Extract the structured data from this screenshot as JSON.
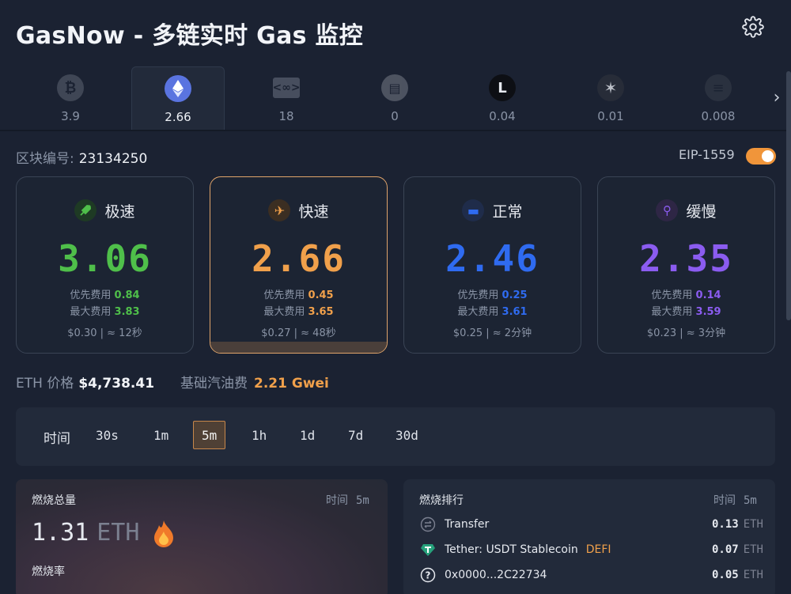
{
  "header": {
    "title": "GasNow - 多链实时 Gas 监控"
  },
  "chains": [
    {
      "icon": "bitcoin-icon",
      "value": "3.9"
    },
    {
      "icon": "ethereum-icon",
      "value": "2.66",
      "active": true
    },
    {
      "icon": "chain-link-icon",
      "value": "18"
    },
    {
      "icon": "scroll-icon",
      "value": "0"
    },
    {
      "icon": "linea-icon",
      "value": "0.04"
    },
    {
      "icon": "starknet-icon",
      "value": "0.01"
    },
    {
      "icon": "dim-chain-icon",
      "value": "0.008"
    }
  ],
  "block": {
    "label": "区块编号:",
    "number": "23134250"
  },
  "eip": {
    "label": "EIP-1559",
    "enabled": true
  },
  "cards": [
    {
      "title": "极速",
      "price": "3.06",
      "priority_label": "优先费用",
      "priority": "0.84",
      "max_label": "最大费用",
      "max": "3.83",
      "footer": "$0.30 | ≈ 12秒",
      "color": "#4fbf4a",
      "icon": "rocket-icon"
    },
    {
      "title": "快速",
      "price": "2.66",
      "priority_label": "优先费用",
      "priority": "0.45",
      "max_label": "最大费用",
      "max": "3.65",
      "footer": "$0.27 | ≈ 48秒",
      "color": "#f0a04b",
      "icon": "plane-icon"
    },
    {
      "title": "正常",
      "price": "2.46",
      "priority_label": "优先费用",
      "priority": "0.25",
      "max_label": "最大费用",
      "max": "3.61",
      "footer": "$0.25 | ≈ 2分钟",
      "color": "#2f6bf0",
      "icon": "car-icon"
    },
    {
      "title": "缓慢",
      "price": "2.35",
      "priority_label": "优先费用",
      "priority": "0.14",
      "max_label": "最大费用",
      "max": "3.59",
      "footer": "$0.23 | ≈ 3分钟",
      "color": "#8b5cf0",
      "icon": "bike-icon"
    }
  ],
  "stats": {
    "eth_label": "ETH 价格",
    "eth_price": "$4,738.41",
    "base_label": "基础汽油费",
    "base_fee": "2.21 Gwei"
  },
  "time_filter": {
    "label": "时间",
    "options": [
      "30s",
      "1m",
      "5m",
      "1h",
      "1d",
      "7d",
      "30d"
    ],
    "selected": "5m"
  },
  "burn": {
    "title": "燃烧总量",
    "time_label": "时间",
    "time_value": "5m",
    "amount": "1.31",
    "unit": "ETH",
    "rate_label": "燃烧率"
  },
  "ranking": {
    "title": "燃烧排行",
    "time_label": "时间",
    "time_value": "5m",
    "items": [
      {
        "name": "Transfer",
        "tag": "",
        "amount": "0.13",
        "unit": "ETH",
        "icon": "transfer-icon"
      },
      {
        "name": "Tether: USDT Stablecoin",
        "tag": "DEFI",
        "amount": "0.07",
        "unit": "ETH",
        "icon": "tether-icon"
      },
      {
        "name": "0x0000...2C22734",
        "tag": "",
        "amount": "0.05",
        "unit": "ETH",
        "icon": "question-icon"
      }
    ]
  }
}
